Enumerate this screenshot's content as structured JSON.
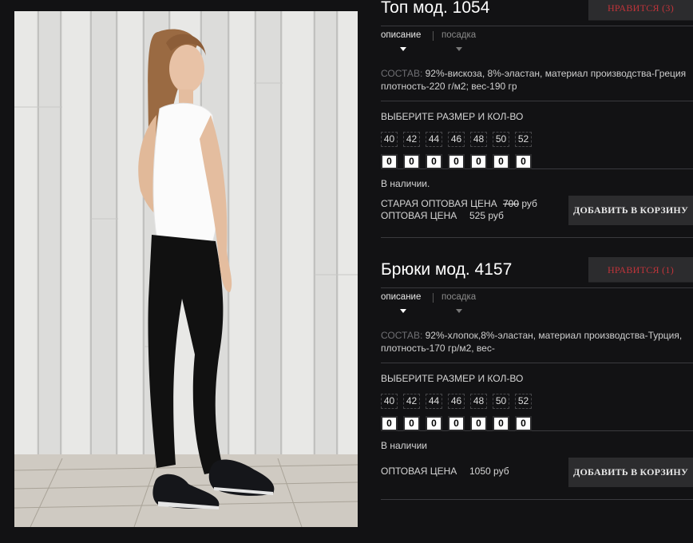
{
  "products": [
    {
      "title": "Топ мод. 1054",
      "like_label": "НРАВИТСЯ (3)",
      "tabs": [
        "описание",
        "посадка"
      ],
      "composition_label": "СОСТАВ:",
      "composition_text": "92%-вискоза, 8%-эластан, материал производства-Греция плотность-220 г/м2; вес-190 гр",
      "size_heading": "ВЫБЕРИТЕ РАЗМЕР И КОЛ-ВО",
      "sizes": [
        "40",
        "42",
        "44",
        "46",
        "48",
        "50",
        "52"
      ],
      "quantities": [
        "0",
        "0",
        "0",
        "0",
        "0",
        "0",
        "0"
      ],
      "availability": "В наличии.",
      "old_price_label": "СТАРАЯ ОПТОВАЯ ЦЕНА",
      "old_price_value": "700",
      "old_price_unit": "руб",
      "price_label": "ОПТОВАЯ ЦЕНА",
      "price_value": "525 руб",
      "cart_label": "ДОБАВИТЬ В КОРЗИНУ"
    },
    {
      "title": "Брюки мод. 4157",
      "like_label": "НРАВИТСЯ (1)",
      "tabs": [
        "описание",
        "посадка"
      ],
      "composition_label": "СОСТАВ:",
      "composition_text": "92%-хлопок,8%-эластан, материал производства-Турция, плотность-170 гр/м2, вес-",
      "size_heading": "ВЫБЕРИТЕ РАЗМЕР И КОЛ-ВО",
      "sizes": [
        "40",
        "42",
        "44",
        "46",
        "48",
        "50",
        "52"
      ],
      "quantities": [
        "0",
        "0",
        "0",
        "0",
        "0",
        "0",
        "0"
      ],
      "availability": "В наличии",
      "price_label": "ОПТОВАЯ ЦЕНА",
      "price_value": "1050 руб",
      "cart_label": "ДОБАВИТЬ В КОРЗИНУ"
    }
  ],
  "colors": {
    "background": "#121214",
    "button": "#2c2c2e",
    "like_text": "#c0343a"
  }
}
